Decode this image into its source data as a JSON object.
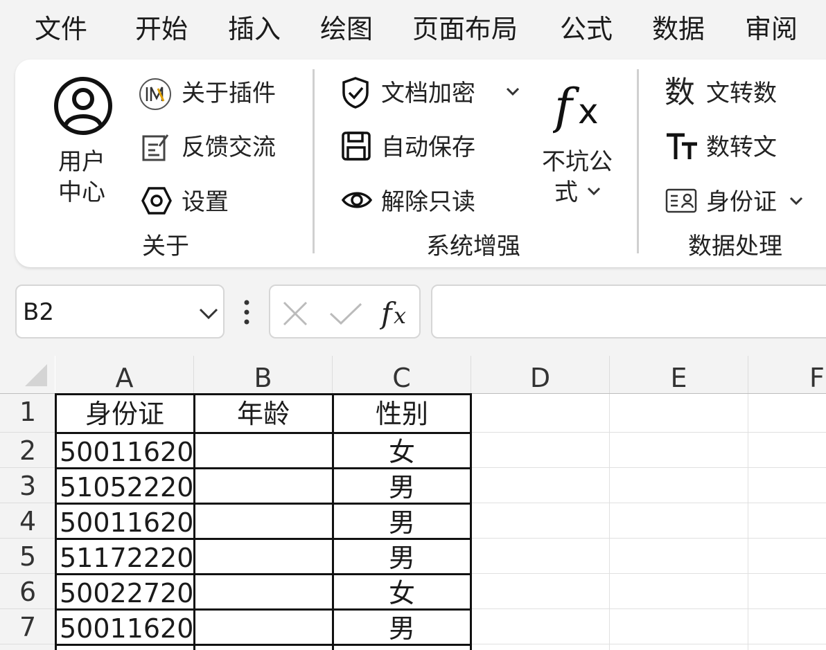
{
  "menu": {
    "items": [
      "文件",
      "开始",
      "插入",
      "绘图",
      "页面布局",
      "公式",
      "数据",
      "审阅"
    ]
  },
  "ribbon": {
    "about_group": {
      "label": "关于",
      "user_center_line1": "用户",
      "user_center_line2": "中心",
      "about_plugin": "关于插件",
      "feedback": "反馈交流",
      "settings": "设置"
    },
    "system_group": {
      "label": "系统增强",
      "encrypt": "文档加密",
      "autosave": "自动保存",
      "unlock_readonly": "解除只读",
      "formula_line1": "不坑公",
      "formula_line2": "式"
    },
    "data_group": {
      "label": "数据处理",
      "text_to_number_icon": "数",
      "text_to_number": "文转数",
      "number_to_text": "数转文",
      "id_card": "身份证"
    }
  },
  "formula_bar": {
    "name_box": "B2",
    "formula": ""
  },
  "sheet": {
    "columns": [
      "A",
      "B",
      "C",
      "D",
      "E",
      "F"
    ],
    "rows": [
      "1",
      "2",
      "3",
      "4",
      "5",
      "6",
      "7"
    ],
    "cells": [
      [
        "身份证",
        "年龄",
        "性别"
      ],
      [
        "50011620",
        "",
        "女"
      ],
      [
        "51052220",
        "",
        "男"
      ],
      [
        "50011620",
        "",
        "男"
      ],
      [
        "51172220",
        "",
        "男"
      ],
      [
        "50022720",
        "",
        "女"
      ],
      [
        "50011620",
        "",
        "男"
      ]
    ]
  },
  "icons": {
    "user": "user-circle-icon",
    "plugin": "plugin-logo-icon",
    "feedback": "edit-note-icon",
    "settings": "hexagon-settings-icon",
    "encrypt": "shield-check-icon",
    "autosave": "floppy-disk-icon",
    "unlock": "eye-icon",
    "formula": "fx-icon",
    "number_to_text": "text-size-icon",
    "id_card": "id-card-icon"
  }
}
